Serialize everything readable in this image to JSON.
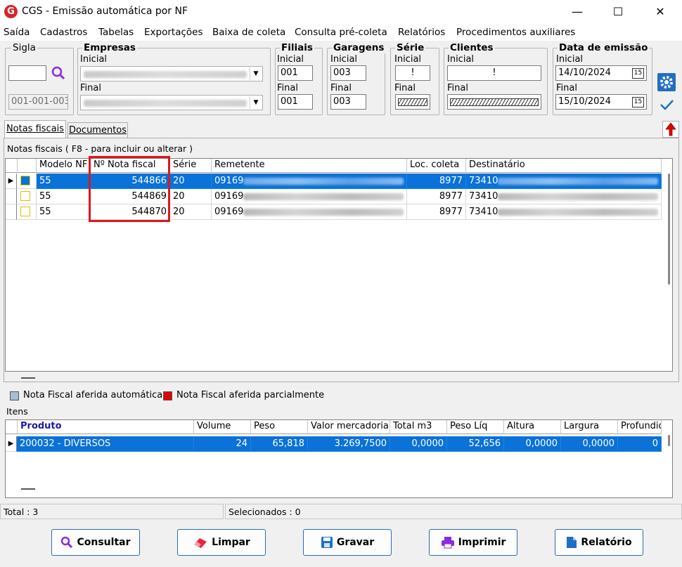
{
  "window": {
    "title": "CGS - Emissão automática por NF",
    "logo_letter": "G",
    "minimize": "—",
    "maximize": "☐",
    "close": "✕"
  },
  "menu": [
    "Saída",
    "Cadastros",
    "Tabelas",
    "Exportações",
    "Baixa de coleta",
    "Consulta pré-coleta",
    "Relatórios",
    "Procedimentos auxiliares"
  ],
  "filters": {
    "sigla": {
      "label": "Sigla",
      "value": "",
      "code": "001-001-003"
    },
    "empresas": {
      "label": "Empresas",
      "initial_label": "Inicial",
      "final_label": "Final"
    },
    "filiais": {
      "label": "Filiais",
      "initial_label": "Inicial",
      "initial": "001",
      "final_label": "Final",
      "final": "001"
    },
    "garagens": {
      "label": "Garagens",
      "initial_label": "Inicial",
      "initial": "003",
      "final_label": "Final",
      "final": "003"
    },
    "serie": {
      "label": "Série",
      "initial_label": "Inicial",
      "initial": "!",
      "final_label": "Final"
    },
    "clientes": {
      "label": "Clientes",
      "initial_label": "Inicial",
      "initial": "!",
      "final_label": "Final"
    },
    "data": {
      "label": "Data de emissão",
      "initial_label": "Inicial",
      "initial": "14/10/2024",
      "final_label": "Final",
      "final": "15/10/2024",
      "cal_icon": "15"
    }
  },
  "tabs": [
    "Notas fiscais",
    "Documentos"
  ],
  "notas": {
    "caption": "Notas fiscais ( F8 - para incluir ou alterar )",
    "columns": [
      "Modelo NF",
      "Nº Nota fiscal",
      "Série",
      "Remetente",
      "Loc. coleta",
      "Destinatário"
    ],
    "rows": [
      {
        "modelo": "55",
        "numero": "544866",
        "serie": "20",
        "remetente": "09169",
        "loc": "8977",
        "dest": "73410",
        "selected": true
      },
      {
        "modelo": "55",
        "numero": "544869",
        "serie": "20",
        "remetente": "09169",
        "loc": "8977",
        "dest": "73410",
        "selected": false
      },
      {
        "modelo": "55",
        "numero": "544870",
        "serie": "20",
        "remetente": "09169",
        "loc": "8977",
        "dest": "73410",
        "selected": false
      }
    ]
  },
  "legend": {
    "auto": "Nota Fiscal aferida automática",
    "auto_color": "#a9bdd6",
    "partial": "Nota Fiscal aferida parcialmente",
    "partial_color": "#e00000"
  },
  "itens": {
    "caption": "Itens",
    "columns": [
      "Produto",
      "Volume",
      "Peso",
      "Valor mercadoria",
      "Total m3",
      "Peso Líq",
      "Altura",
      "Largura",
      "Profundid"
    ],
    "rows": [
      {
        "produto": "200032 - DIVERSOS",
        "volume": "24",
        "peso": "65,818",
        "valor": "3.269,7500",
        "total_m3": "0,0000",
        "peso_liq": "52,656",
        "altura": "0,0000",
        "largura": "0,0000",
        "profundidade": "0"
      }
    ]
  },
  "status": {
    "total": "Total : 3",
    "selecionados": "Selecionados : 0"
  },
  "buttons": {
    "consultar": "Consultar",
    "limpar": "Limpar",
    "gravar": "Gravar",
    "imprimir": "Imprimir",
    "relatorio": "Relatório"
  },
  "colors": {
    "selection": "#0a72d8",
    "highlight_box": "#d9191e",
    "accent": "#2d6bb5"
  }
}
